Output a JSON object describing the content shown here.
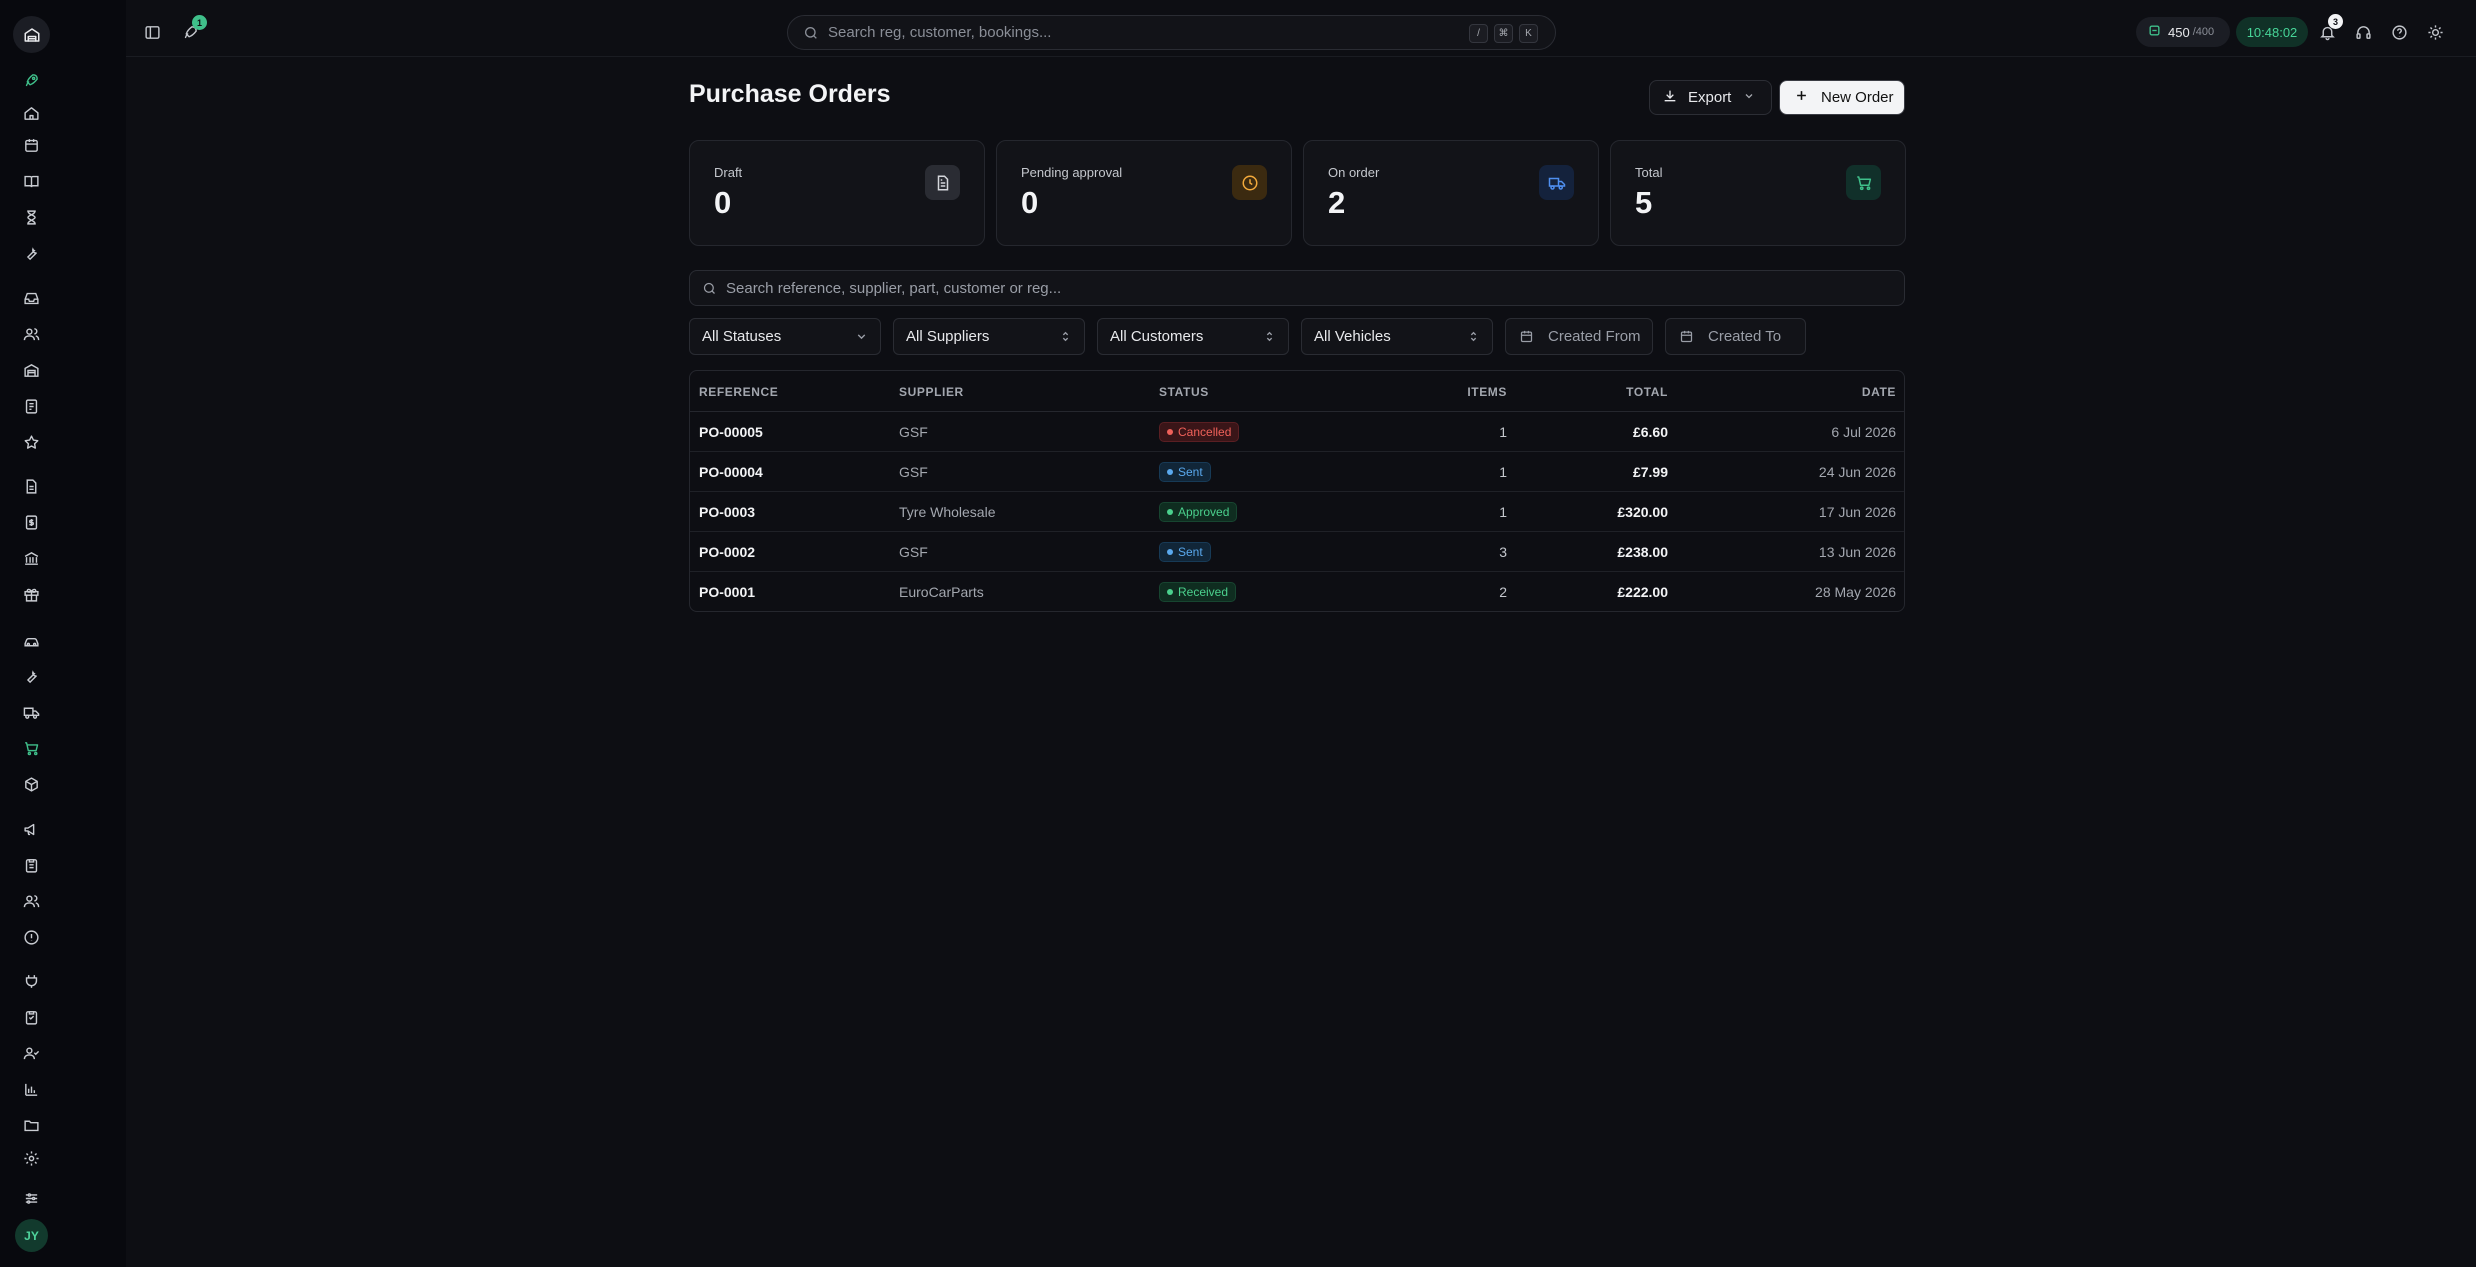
{
  "colors": {
    "accent": "#3fbf8a",
    "cancelled": "#f0615a",
    "sent": "#5aa9ee",
    "approved": "#4bd08d",
    "received": "#4bd08d"
  },
  "sidebar": {
    "icons": [
      "rocket-icon",
      "home-icon",
      "calendar-icon",
      "book-icon",
      "hourglass-icon",
      "wrench-icon",
      "inbox-icon",
      "users-icon",
      "warehouse-icon",
      "receipt-icon",
      "star-icon",
      "document-icon",
      "invoice-icon",
      "bank-icon",
      "gift-icon",
      "car-icon",
      "tools-icon",
      "truck-icon",
      "cart-icon",
      "package-icon",
      "megaphone-icon",
      "clipboard-icon",
      "team-icon",
      "info-icon",
      "plugin-icon",
      "checklist-icon",
      "user-check-icon",
      "chart-icon",
      "folder-icon",
      "settings-icon",
      "sliders-icon"
    ],
    "avatar": "JY"
  },
  "topbar": {
    "search_placeholder": "Search reg, customer, bookings...",
    "kbd": [
      "/",
      "⌘",
      "K"
    ],
    "rocket_badge": "1",
    "credits_value": "450",
    "credits_max": "/400",
    "clock": "10:48:02",
    "notifications_badge": "3"
  },
  "page": {
    "title": "Purchase Orders",
    "export_label": "Export",
    "new_order_label": "New Order"
  },
  "stats": [
    {
      "label": "Draft",
      "value": "0",
      "icon": "document-icon"
    },
    {
      "label": "Pending approval",
      "value": "0",
      "icon": "clock-icon"
    },
    {
      "label": "On order",
      "value": "2",
      "icon": "truck-icon"
    },
    {
      "label": "Total",
      "value": "5",
      "icon": "cart-icon"
    }
  ],
  "search": {
    "placeholder": "Search reference, supplier, part, customer or reg..."
  },
  "filters": {
    "status": "All Statuses",
    "suppliers": "All Suppliers",
    "customers": "All Customers",
    "vehicles": "All Vehicles",
    "created_from": "Created From",
    "created_to": "Created To"
  },
  "table": {
    "headers": {
      "reference": "REFERENCE",
      "supplier": "SUPPLIER",
      "status": "STATUS",
      "items": "ITEMS",
      "total": "TOTAL",
      "date": "DATE"
    },
    "rows": [
      {
        "reference": "PO-00005",
        "supplier": "GSF",
        "status": "Cancelled",
        "items": "1",
        "total": "£6.60",
        "date": "6 Jul 2026"
      },
      {
        "reference": "PO-00004",
        "supplier": "GSF",
        "status": "Sent",
        "items": "1",
        "total": "£7.99",
        "date": "24 Jun 2026"
      },
      {
        "reference": "PO-0003",
        "supplier": "Tyre Wholesale",
        "status": "Approved",
        "items": "1",
        "total": "£320.00",
        "date": "17 Jun 2026"
      },
      {
        "reference": "PO-0002",
        "supplier": "GSF",
        "status": "Sent",
        "items": "3",
        "total": "£238.00",
        "date": "13 Jun 2026"
      },
      {
        "reference": "PO-0001",
        "supplier": "EuroCarParts",
        "status": "Received",
        "items": "2",
        "total": "£222.00",
        "date": "28 May 2026"
      }
    ]
  }
}
